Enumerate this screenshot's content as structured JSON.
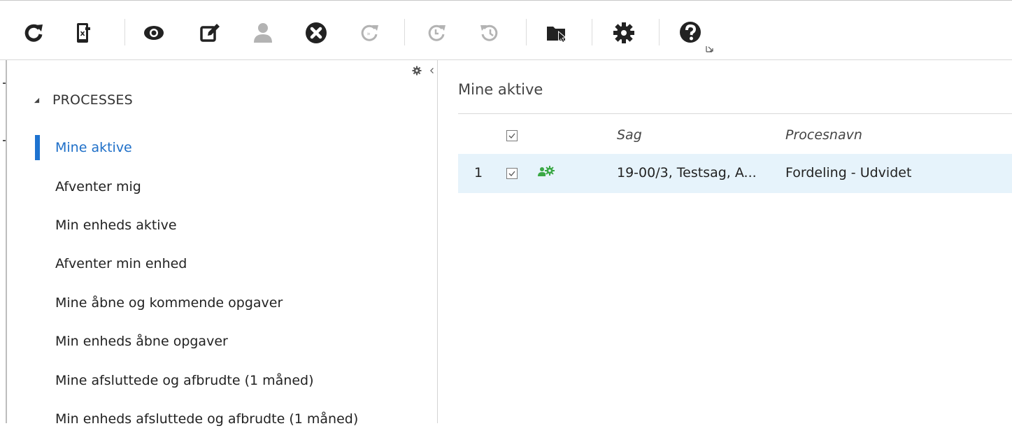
{
  "toolbar": {
    "buttons": [
      {
        "icon": "refresh-icon",
        "enabled": true
      },
      {
        "icon": "excel-export-icon",
        "enabled": true
      },
      {
        "icon": "view-eye-icon",
        "enabled": true
      },
      {
        "icon": "edit-icon",
        "enabled": true
      },
      {
        "icon": "user-icon",
        "enabled": false
      },
      {
        "icon": "cancel-circle-icon",
        "enabled": true
      },
      {
        "icon": "forward-refresh-icon",
        "enabled": false
      },
      {
        "icon": "redo-clock-icon",
        "enabled": false
      },
      {
        "icon": "history-icon",
        "enabled": false
      },
      {
        "icon": "folder-select-icon",
        "enabled": true
      },
      {
        "icon": "settings-gear-icon",
        "enabled": true
      },
      {
        "icon": "help-icon",
        "enabled": true
      }
    ],
    "colors": {
      "enabled": "#222222",
      "disabled": "#b3b3b3"
    }
  },
  "sidebar": {
    "section_title": "PROCESSES",
    "items": [
      {
        "label": "Mine aktive",
        "active": true
      },
      {
        "label": "Afventer mig",
        "active": false
      },
      {
        "label": "Min enheds aktive",
        "active": false
      },
      {
        "label": "Afventer min enhed",
        "active": false
      },
      {
        "label": "Mine åbne og kommende opgaver",
        "active": false
      },
      {
        "label": "Min enheds åbne opgaver",
        "active": false
      },
      {
        "label": "Mine afsluttede og afbrudte (1 måned)",
        "active": false
      },
      {
        "label": "Min enheds afsluttede og afbrudte (1 måned)",
        "active": false
      }
    ],
    "active_color": "#1e73d0"
  },
  "main": {
    "title": "Mine aktive",
    "columns": [
      "Sag",
      "Procesnavn"
    ],
    "rows": [
      {
        "index": "1",
        "checked": true,
        "status_icon": "process-gear-icon",
        "sag": "19-00/3, Testsag, A...",
        "procesnavn": "Fordeling - Udvidet"
      }
    ],
    "row_highlight": "#e6f3fb",
    "status_icon_color": "#3aa845"
  }
}
